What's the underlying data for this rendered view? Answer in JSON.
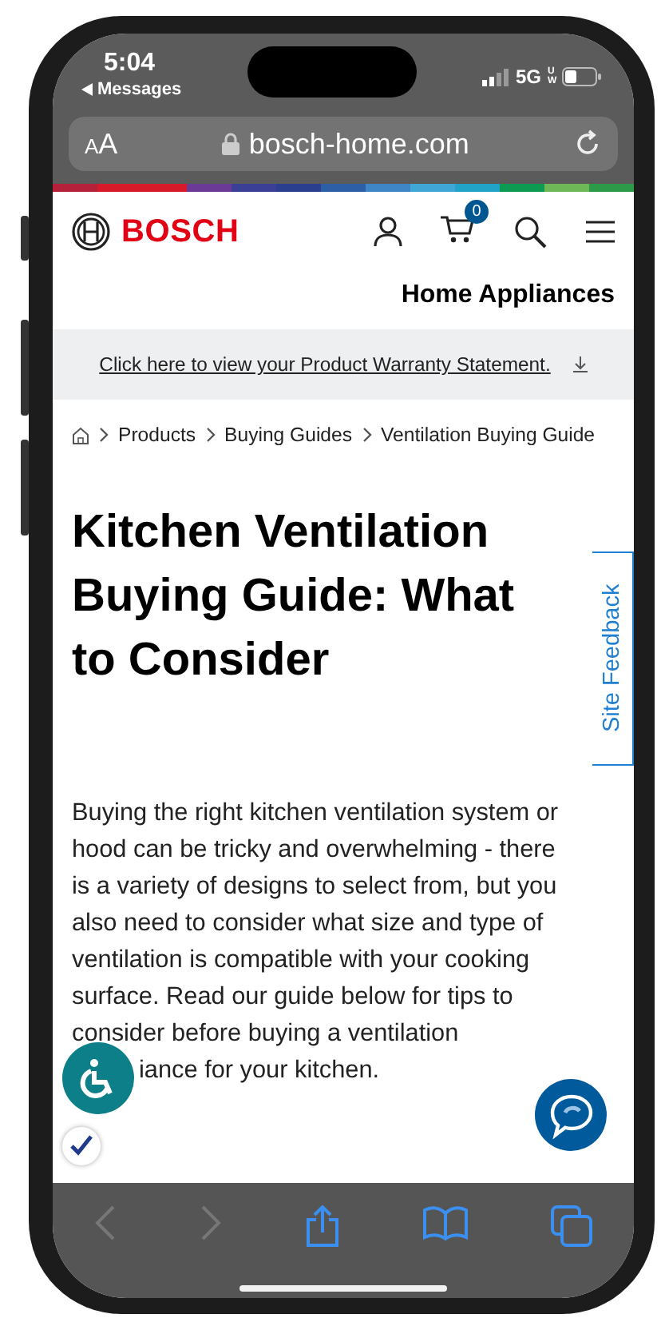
{
  "status_bar": {
    "time": "5:04",
    "back_label": "Messages",
    "network": "5G",
    "network_badge": "UW"
  },
  "address_bar": {
    "text_size_glyphs": [
      "A",
      "A"
    ],
    "url": "bosch-home.com"
  },
  "header": {
    "brand": "BOSCH",
    "cart_count": "0",
    "section_title": "Home Appliances"
  },
  "notice": {
    "link": "Click here to view your Product Warranty Statement."
  },
  "breadcrumb": [
    "Products",
    "Buying Guides",
    "Ventilation Buying Guide"
  ],
  "title": "Kitchen Ventilation\nBuying Guide: What\nto Consider",
  "intro": "Buying the right kitchen ventilation system or\nhood can be tricky and overwhelming - there\nis a variety of designs to select from, but you\nalso need to consider what size and type of\nventilation is compatible with your cooking\nsurface. Read our guide below for tips to\nconsider before buying a ventilation",
  "intro_last_line": "iance for your kitchen.",
  "feedback_tab": "Site Feedback"
}
